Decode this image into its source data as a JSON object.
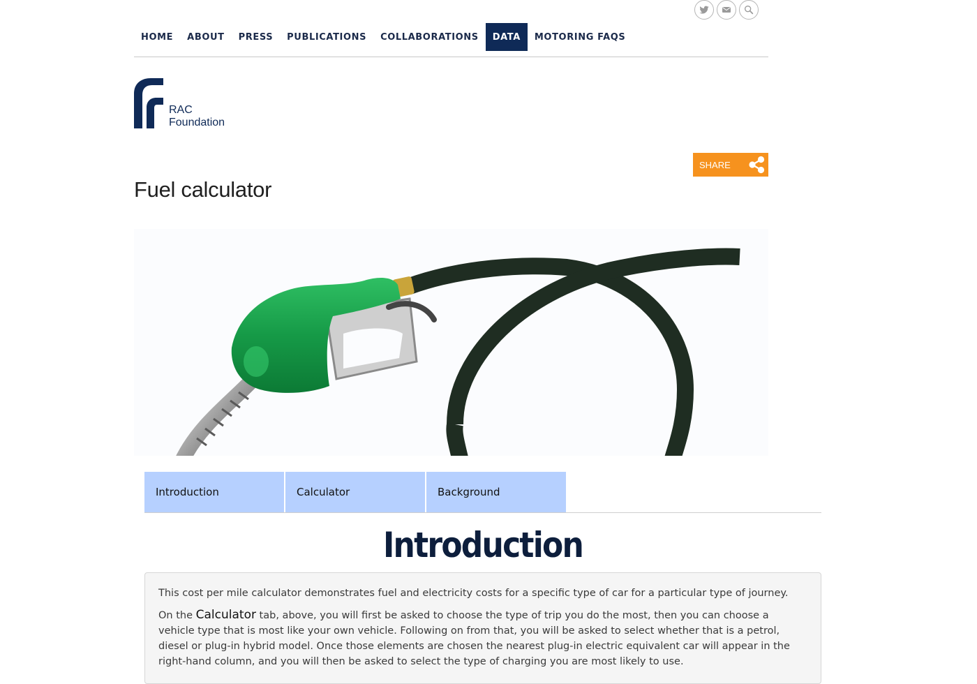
{
  "social": {
    "twitter_icon": "twitter-icon",
    "email_icon": "email-icon",
    "search_icon": "search-icon"
  },
  "nav": {
    "items": [
      "HOME",
      "ABOUT",
      "PRESS",
      "PUBLICATIONS",
      "COLLABORATIONS",
      "DATA",
      "MOTORING FAQS"
    ],
    "active": "DATA",
    "active_color": "#0f2a57"
  },
  "logo": {
    "line1": "RAC",
    "line2": "Foundation",
    "brand_color": "#0f2a57"
  },
  "share": {
    "label": "SHARE",
    "color": "#f6921e"
  },
  "page": {
    "title": "Fuel calculator"
  },
  "hero": {
    "image": "fuel-pump-nozzle-image"
  },
  "tabs": [
    "Introduction",
    "Calculator",
    "Background"
  ],
  "tab_color": "#b6d0ff",
  "section": {
    "title": "Introduction",
    "para1": "This cost per mile calculator demonstrates fuel and electricity costs for a specific type of car for a particular type of journey.",
    "para2_prefix": "On the ",
    "para2_bold": "Calculator",
    "para2_rest": " tab, above, you will first be asked to choose the type of trip you do the most, then you can choose a vehicle type that is most like your own vehicle. Following on from that, you will be asked to select whether that is a petrol, diesel or plug-in hybrid model. Once those elements are chosen the nearest plug-in electric equivalent car will appear in the right-hand column, and you will then be asked to select the type of charging you are most likely to use."
  }
}
